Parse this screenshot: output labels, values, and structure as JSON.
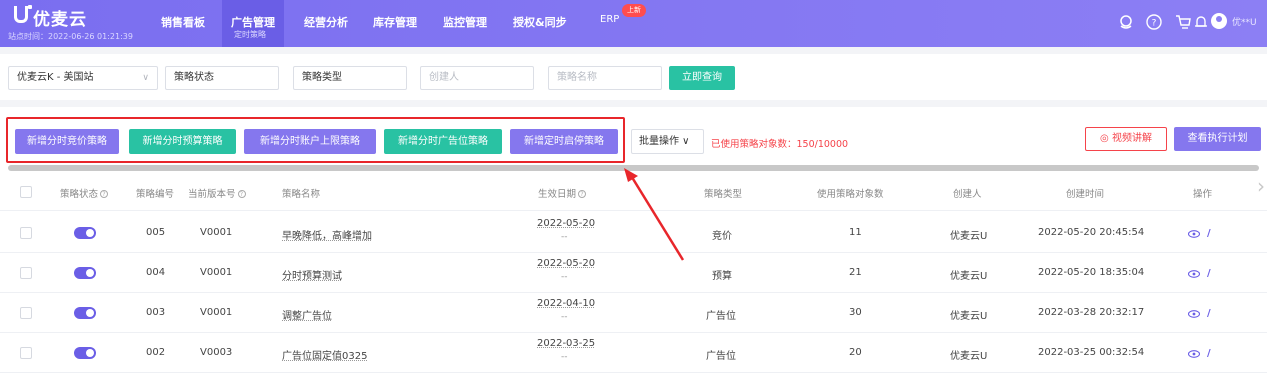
{
  "header": {
    "brand": "优麦云",
    "site_time": "站点时间：2022-06-26 01:21:39",
    "nav": [
      {
        "label": "销售看板"
      },
      {
        "label": "广告管理",
        "sub": "定时策略",
        "active": true
      },
      {
        "label": "经营分析"
      },
      {
        "label": "库存管理"
      },
      {
        "label": "监控管理"
      },
      {
        "label": "授权&同步"
      },
      {
        "label": "ERP",
        "badge": "上新"
      }
    ],
    "icons": [
      "service-icon",
      "help-icon",
      "cart-icon",
      "bell-icon",
      "user-icon"
    ],
    "username": "优**U"
  },
  "filters": {
    "shop": "优麦云K - 美国站",
    "status_placeholder": "策略状态",
    "type_placeholder": "策略类型",
    "creator_placeholder": "创建人",
    "name_placeholder": "策略名称",
    "query_button": "立即查询"
  },
  "actions": {
    "buttons": [
      "新增分时竞价策略",
      "新增分时预算策略",
      "新增分时账户上限策略",
      "新增分时广告位策略",
      "新增定时启停策略"
    ],
    "batch": "批量操作",
    "used_text": "已使用策略对象数：150/10000",
    "video_button": "视频讲解",
    "plan_button": "查看执行计划"
  },
  "table": {
    "headers": [
      "策略状态",
      "策略编号",
      "当前版本号",
      "策略名称",
      "生效日期",
      "策略类型",
      "使用策略对象数",
      "创建人",
      "创建时间",
      "操作"
    ],
    "rows": [
      {
        "id": "005",
        "version": "V0001",
        "name": "早晚降低，高峰增加",
        "date": "2022-05-20",
        "date_end": "--",
        "type": "竞价",
        "count": "11",
        "creator": "优麦云U",
        "created": "2022-05-20 20:45:54"
      },
      {
        "id": "004",
        "version": "V0001",
        "name": "分时预算测试",
        "date": "2022-05-20",
        "date_end": "--",
        "type": "预算",
        "count": "21",
        "creator": "优麦云U",
        "created": "2022-05-20 18:35:04"
      },
      {
        "id": "003",
        "version": "V0001",
        "name": "调整广告位",
        "date": "2022-04-10",
        "date_end": "--",
        "type": "广告位",
        "count": "30",
        "creator": "优麦云U",
        "created": "2022-03-28 20:32:17"
      },
      {
        "id": "002",
        "version": "V0003",
        "name": "广告位固定值0325",
        "date": "2022-03-25",
        "date_end": "--",
        "type": "广告位",
        "count": "20",
        "creator": "优麦云U",
        "created": "2022-03-25 00:32:54"
      }
    ]
  },
  "colors": {
    "primary": "#8577ee",
    "accent": "#29c2a3",
    "danger": "#f5434a"
  }
}
